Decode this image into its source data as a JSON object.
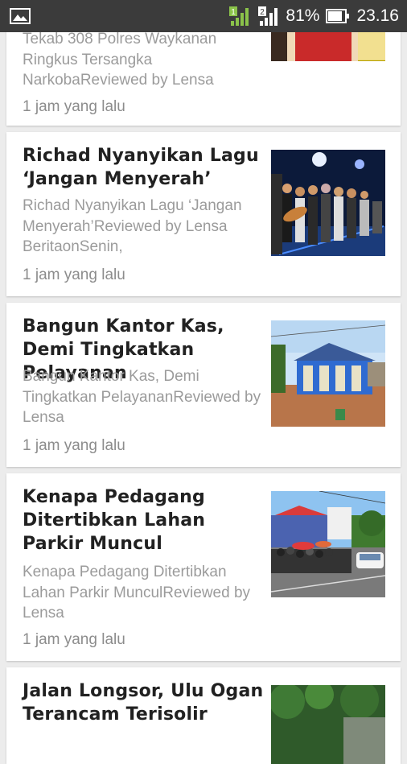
{
  "status_bar": {
    "battery_percent": "81%",
    "time": "23.16",
    "sim1_label": "1",
    "sim2_label": "2",
    "icons": [
      "gallery-icon",
      "signal-sim1-icon",
      "signal-sim2-icon",
      "battery-icon"
    ]
  },
  "articles": [
    {
      "title": "",
      "snippet": "Tekab 308 Polres Waykanan Ringkus Tersangka NarkobaReviewed by Lensa",
      "time": "1 jam yang lalu"
    },
    {
      "title": "Richad Nyanyikan Lagu ‘Jangan Menyerah’",
      "snippet": "Richad Nyanyikan Lagu ‘Jangan Menyerah’Reviewed by Lensa BeritaonSenin,",
      "time": "1 jam yang lalu"
    },
    {
      "title": "Bangun Kantor Kas, Demi Tingkatkan Pelayanan",
      "snippet": "Bangun Kantor Kas, Demi Tingkatkan PelayananReviewed by Lensa",
      "time": "1 jam yang lalu"
    },
    {
      "title": "Kenapa Pedagang Ditertibkan  Lahan Parkir Muncul",
      "snippet": "Kenapa Pedagang Ditertibkan Lahan Parkir MunculReviewed by Lensa",
      "time": "1 jam yang lalu"
    },
    {
      "title": "Jalan Longsor, Ulu Ogan Terancam Terisolir",
      "snippet": "",
      "time": ""
    }
  ]
}
